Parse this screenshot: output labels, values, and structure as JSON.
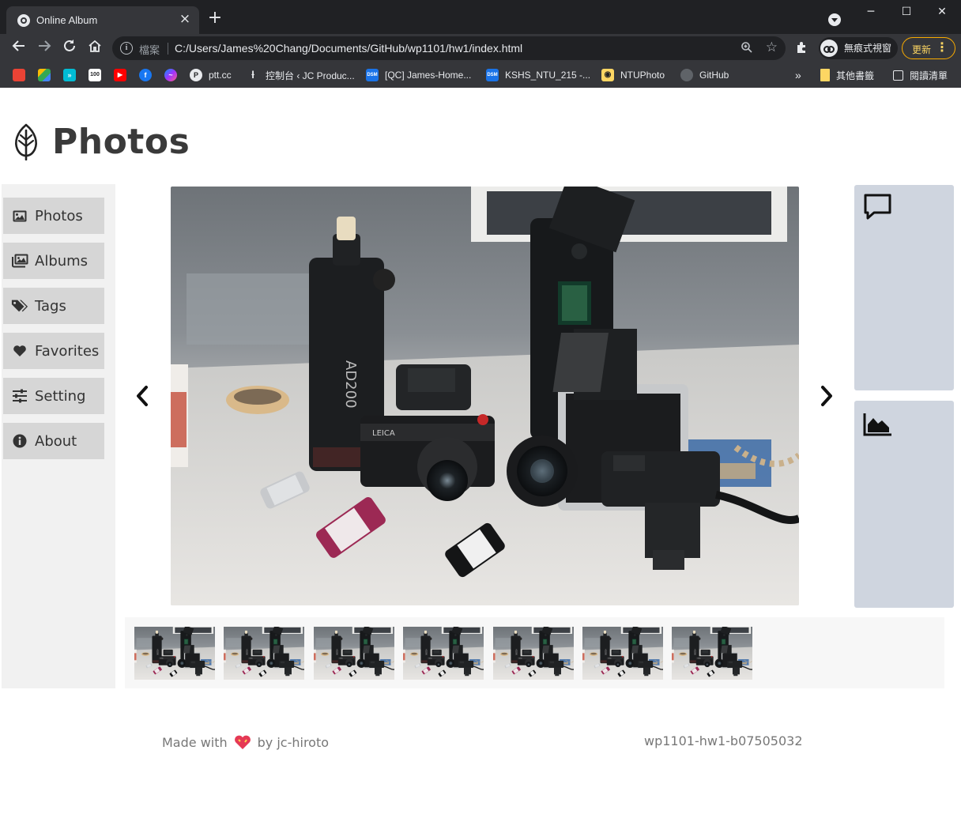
{
  "browser": {
    "tab_title": "Online Album",
    "new_tab_symbol": "+",
    "window_controls": {
      "minimize": "─",
      "maximize": "☐",
      "close": "✕"
    },
    "address": {
      "scheme_label": "檔案",
      "url": "C:/Users/James%20Chang/Documents/GitHub/wp1101/hw1/index.html"
    },
    "incognito_label": "無痕式視窗",
    "update_label": "更新",
    "bookmarks": [
      {
        "label": "",
        "icon": "apps-icon",
        "color": "#e8eaed"
      },
      {
        "label": "",
        "icon": "drive-icon",
        "color": "#34a853"
      },
      {
        "label": "",
        "icon": "forward-icon",
        "color": "#00bcd4"
      },
      {
        "label": "",
        "icon": "calendar-icon",
        "color": "#ffffff"
      },
      {
        "label": "",
        "icon": "youtube-icon",
        "color": "#ff0000"
      },
      {
        "label": "",
        "icon": "facebook-icon",
        "color": "#1877f2"
      },
      {
        "label": "",
        "icon": "messenger-icon",
        "color": "#a033ff"
      },
      {
        "label": "ptt.cc",
        "icon": "p-icon",
        "color": "#e8eaed"
      },
      {
        "label": "控制台 ‹ JC Produc...",
        "icon": "jc-icon",
        "color": "#e8eaed"
      },
      {
        "label": "[QC] James-Home...",
        "icon": "dsm-icon",
        "color": "#1a73e8"
      },
      {
        "label": "KSHS_NTU_215 -...",
        "icon": "dsm-icon",
        "color": "#1a73e8"
      },
      {
        "label": "NTUPhoto",
        "icon": "camera-icon",
        "color": "#fdd663"
      },
      {
        "label": "GitHub",
        "icon": "github-icon",
        "color": "#5f6368"
      }
    ],
    "overflow_symbol": "»",
    "other_bookmarks": "其他書籤",
    "reading_list": "閱讀清單"
  },
  "header": {
    "title": "Photos"
  },
  "sidebar": {
    "items": [
      {
        "label": "Photos",
        "icon": "image-icon"
      },
      {
        "label": "Albums",
        "icon": "images-icon"
      },
      {
        "label": "Tags",
        "icon": "tags-icon"
      },
      {
        "label": "Favorites",
        "icon": "heart-icon"
      },
      {
        "label": "Setting",
        "icon": "sliders-icon"
      },
      {
        "label": "About",
        "icon": "info-circle-icon"
      }
    ]
  },
  "viewer": {
    "prev_icon": "chevron-left-icon",
    "next_icon": "chevron-right-icon"
  },
  "side_panels": [
    {
      "icon": "comment-icon"
    },
    {
      "icon": "area-chart-icon"
    }
  ],
  "thumbnails": {
    "count": 7
  },
  "footer": {
    "made_with": "Made with",
    "by": "by jc-hiroto",
    "id": "wp1101-hw1-b07505032"
  }
}
